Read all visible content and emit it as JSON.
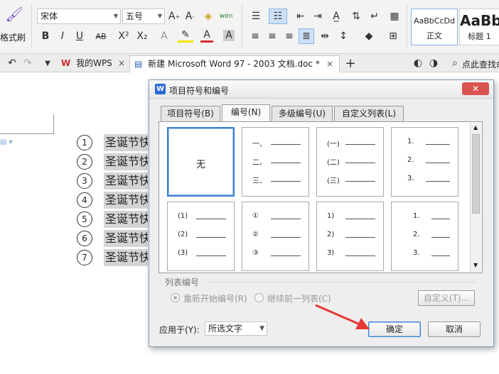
{
  "ribbon": {
    "format_painter_label": "格式刷",
    "font_name": "宋体",
    "font_size": "五号",
    "style_normal_preview": "AaBbCcDd",
    "style_normal_label": "正文",
    "style_h1_preview": "AaBb",
    "style_h1_label": "标题 1"
  },
  "tabs": {
    "wps_label": "我的WPS",
    "doc_label": "新建 Microsoft Word 97 - 2003 文档.doc *",
    "search_label": "点此查找命"
  },
  "document": {
    "items": [
      {
        "num": "1",
        "text": "圣诞节快乐"
      },
      {
        "num": "2",
        "text": "圣诞节快乐"
      },
      {
        "num": "3",
        "text": "圣诞节快乐"
      },
      {
        "num": "4",
        "text": "圣诞节快乐"
      },
      {
        "num": "5",
        "text": "圣诞节快乐"
      },
      {
        "num": "6",
        "text": "圣诞节快乐"
      },
      {
        "num": "7",
        "text": "圣诞节快乐"
      }
    ]
  },
  "dialog": {
    "title": "项目符号和编号",
    "close_label": "✕",
    "tabs": [
      "项目符号(B)",
      "编号(N)",
      "多级编号(U)",
      "自定义列表(L)"
    ],
    "selected_tab": "编号(N)",
    "none_label": "无",
    "formats": {
      "chinese_comma": [
        "一、",
        "二、",
        "三、"
      ],
      "chinese_paren": [
        "(一)",
        "(二)",
        "(三)"
      ],
      "arabic_dot": [
        "1.",
        "2.",
        "3."
      ],
      "arabic_paren_both": [
        "(1)",
        "(2)",
        "(3)"
      ],
      "circled": [
        "①",
        "②",
        "③"
      ],
      "arabic_paren": [
        "1)",
        "2)",
        "3)"
      ],
      "arabic_dot_indent": [
        "1.",
        "2.",
        "3."
      ]
    },
    "list_numbering_label": "列表编号",
    "restart_label": "重新开始编号(R)",
    "continue_label": "继续前一列表(C)",
    "customize_label": "自定义(T)...",
    "apply_to_label": "应用于(Y):",
    "apply_to_value": "所选文字",
    "ok_label": "确定",
    "cancel_label": "取消"
  },
  "colors": {
    "accent": "#3c7fd3",
    "arrow": "#e53935",
    "close": "#d9534f"
  }
}
